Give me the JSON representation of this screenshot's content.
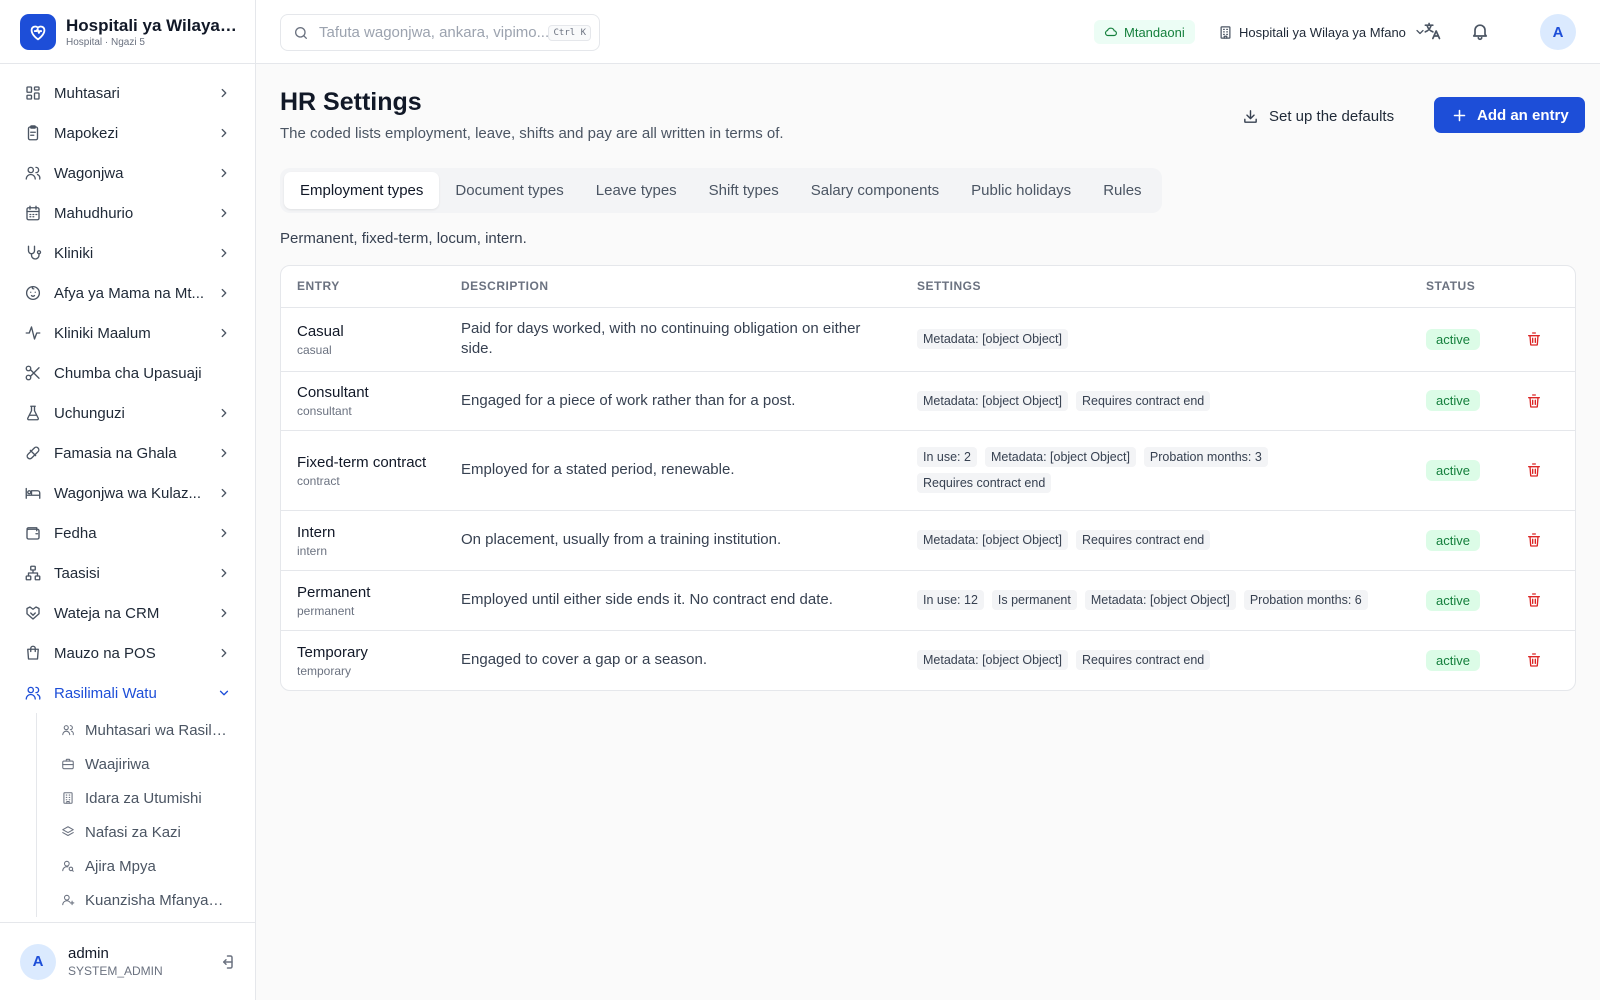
{
  "brand": {
    "name": "Hospitali ya Wilaya ...",
    "sub": "Hospital · Ngazi 5"
  },
  "sidebar": {
    "items": [
      {
        "label": "Muhtasari",
        "icon": "dashboard-icon",
        "chevron": "right"
      },
      {
        "label": "Mapokezi",
        "icon": "clipboard-icon",
        "chevron": "right"
      },
      {
        "label": "Wagonjwa",
        "icon": "users-icon",
        "chevron": "right"
      },
      {
        "label": "Mahudhurio",
        "icon": "calendar-icon",
        "chevron": "right"
      },
      {
        "label": "Kliniki",
        "icon": "stethoscope-icon",
        "chevron": "right"
      },
      {
        "label": "Afya ya Mama na Mt...",
        "icon": "baby-icon",
        "chevron": "right"
      },
      {
        "label": "Kliniki Maalum",
        "icon": "activity-icon",
        "chevron": "right"
      },
      {
        "label": "Chumba cha Upasuaji",
        "icon": "scissors-icon",
        "chevron": "none"
      },
      {
        "label": "Uchunguzi",
        "icon": "flask-icon",
        "chevron": "right"
      },
      {
        "label": "Famasia na Ghala",
        "icon": "pill-icon",
        "chevron": "right"
      },
      {
        "label": "Wagonjwa wa Kulaz...",
        "icon": "bed-icon",
        "chevron": "right"
      },
      {
        "label": "Fedha",
        "icon": "wallet-icon",
        "chevron": "right"
      },
      {
        "label": "Taasisi",
        "icon": "network-icon",
        "chevron": "right"
      },
      {
        "label": "Wateja na CRM",
        "icon": "handshake-icon",
        "chevron": "right"
      },
      {
        "label": "Mauzo na POS",
        "icon": "shopping-bag-icon",
        "chevron": "right"
      },
      {
        "label": "Rasilimali Watu",
        "icon": "users-icon",
        "chevron": "down",
        "active": true
      }
    ],
    "subitems": [
      {
        "label": "Muhtasari wa Rasili...",
        "icon": "users-icon"
      },
      {
        "label": "Waajiriwa",
        "icon": "briefcase-icon"
      },
      {
        "label": "Idara za Utumishi",
        "icon": "building-icon"
      },
      {
        "label": "Nafasi za Kazi",
        "icon": "layers-icon"
      },
      {
        "label": "Ajira Mpya",
        "icon": "user-search-icon"
      },
      {
        "label": "Kuanzisha Mfanyak...",
        "icon": "user-plus-icon"
      }
    ]
  },
  "user": {
    "initial": "A",
    "name": "admin",
    "role": "SYSTEM_ADMIN"
  },
  "topbar": {
    "search_placeholder": "Tafuta wagonjwa, ankara, vipimo...",
    "shortcut": "Ctrl K",
    "status": "Mtandaoni",
    "facility": "Hospitali ya Wilaya ya Mfano",
    "avatar": "A"
  },
  "page": {
    "title": "HR Settings",
    "description": "The coded lists employment, leave, shifts and pay are all written in terms of.",
    "defaults_button": "Set up the defaults",
    "add_button": "Add an entry",
    "tabs": [
      "Employment types",
      "Document types",
      "Leave types",
      "Shift types",
      "Salary components",
      "Public holidays",
      "Rules"
    ],
    "active_tab": 0,
    "tab_description": "Permanent, fixed-term, locum, intern."
  },
  "table": {
    "columns": [
      "ENTRY",
      "DESCRIPTION",
      "SETTINGS",
      "STATUS"
    ],
    "rows": [
      {
        "name": "Casual",
        "code": "casual",
        "description": "Paid for days worked, with no continuing obligation on either side.",
        "settings": [
          "Metadata: [object Object]"
        ],
        "status": "active"
      },
      {
        "name": "Consultant",
        "code": "consultant",
        "description": "Engaged for a piece of work rather than for a post.",
        "settings": [
          "Metadata: [object Object]",
          "Requires contract end"
        ],
        "status": "active"
      },
      {
        "name": "Fixed-term contract",
        "code": "contract",
        "description": "Employed for a stated period, renewable.",
        "settings": [
          "In use: 2",
          "Metadata: [object Object]",
          "Probation months: 3",
          "Requires contract end"
        ],
        "status": "active"
      },
      {
        "name": "Intern",
        "code": "intern",
        "description": "On placement, usually from a training institution.",
        "settings": [
          "Metadata: [object Object]",
          "Requires contract end"
        ],
        "status": "active"
      },
      {
        "name": "Permanent",
        "code": "permanent",
        "description": "Employed until either side ends it. No contract end date.",
        "settings": [
          "In use: 12",
          "Is permanent",
          "Metadata: [object Object]",
          "Probation months: 6"
        ],
        "status": "active"
      },
      {
        "name": "Temporary",
        "code": "temporary",
        "description": "Engaged to cover a gap or a season.",
        "settings": [
          "Metadata: [object Object]",
          "Requires contract end"
        ],
        "status": "active"
      }
    ]
  }
}
